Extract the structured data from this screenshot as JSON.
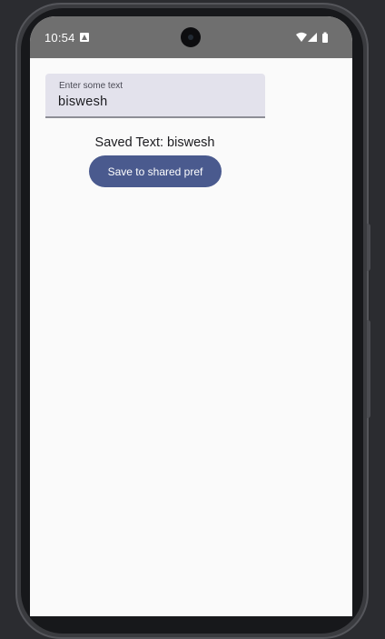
{
  "status_bar": {
    "time": "10:54",
    "icons": [
      "notification-a-icon",
      "wifi-icon",
      "signal-icon",
      "battery-icon"
    ]
  },
  "form": {
    "field_label": "Enter some text",
    "field_value": "biswesh",
    "saved_text": "Saved Text: biswesh",
    "save_button_label": "Save to shared pref"
  },
  "colors": {
    "status_bar": "#6f6f6f",
    "screen_background": "#fafafa",
    "field_background": "#e3e2ec",
    "button_background": "#4a5a8e",
    "button_text": "#ffffff"
  }
}
